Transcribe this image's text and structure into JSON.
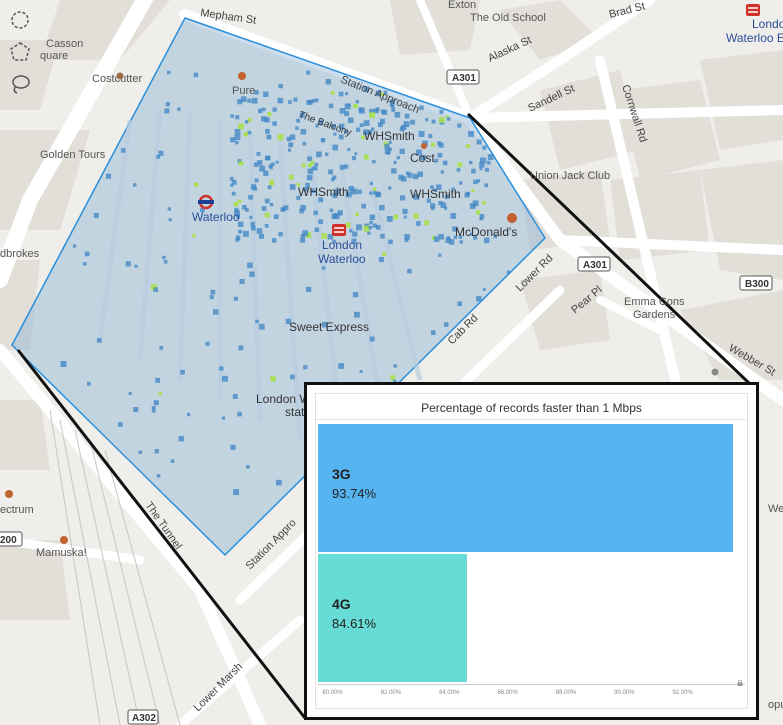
{
  "map": {
    "labels": {
      "mepham_st": "Mepham St",
      "exton": "Exton",
      "old_school": "The Old School",
      "brad_st": "Brad St",
      "london_waterloo_east_1": "London",
      "london_waterloo_east_2": "Waterloo Ea",
      "casson_square_1": "Casson",
      "casson_square_2": "quare",
      "alaska_st": "Alaska St",
      "costcutter": "Costcutter",
      "station_approach_top": "Station Approach",
      "a301_top": "A301",
      "sandell_st": "Sandell St",
      "cornwall_rd": "Cornwall Rd",
      "pure": "Pure",
      "golden_tours": "Golden Tours",
      "balcony": "The Balcony",
      "whsmith_1": "WHSmith",
      "costa": "Cost",
      "union_jack_club": "Union Jack Club",
      "whsmith_2": "WHSmith",
      "whsmith_3": "WHSmith",
      "waterloo_tube": "Waterloo",
      "mcdonalds": "McDonald's",
      "london_waterloo_1": "London",
      "london_waterloo_2": "Waterloo",
      "ladbrokes": "dbrokes",
      "a301_mid": "A301",
      "lower_rd": "Lower Rd",
      "b300": "B300",
      "emma_cons_1": "Emma Cons",
      "emma_cons_2": "Gardens",
      "pear_pl": "Pear Pl",
      "cab_rd": "Cab Rd",
      "sweet_express": "Sweet Express",
      "webber_st": "Webber St",
      "london_w_lower_1": "London W",
      "london_w_lower_2": "stat",
      "spectrum": "ectrum",
      "a200": "200",
      "the_tunnel": "The Tunnel",
      "station_approach_low": "Station Appro",
      "mamuska": "Mamuska!",
      "lower_marsh": "Lower Marsh",
      "a302": "A302",
      "welling": "Wellin",
      "popular": "opular"
    }
  },
  "tools": [
    {
      "name": "circle-select-icon"
    },
    {
      "name": "polygon-select-icon"
    },
    {
      "name": "lasso-select-icon"
    }
  ],
  "chart_data": {
    "type": "bar",
    "orientation": "horizontal",
    "title": "Percentage of records faster than 1 Mbps",
    "categories": [
      "3G",
      "4G"
    ],
    "values": [
      93.74,
      84.61
    ],
    "value_labels": [
      "93.74%",
      "84.61%"
    ],
    "colors": [
      "#56b4f0",
      "#67dcd6"
    ],
    "xlim": [
      79.5,
      94
    ],
    "ticks": [
      "80.00%",
      "82.00%",
      "84.00%",
      "86.00%",
      "88.00%",
      "90.00%",
      "92.00%"
    ],
    "tick_values": [
      80,
      82,
      84,
      86,
      88,
      90,
      92
    ]
  }
}
